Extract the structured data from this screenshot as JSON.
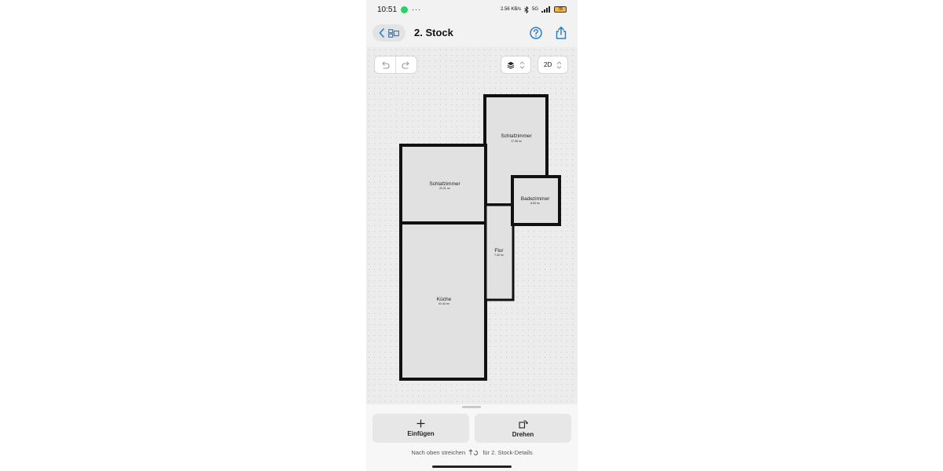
{
  "status_bar": {
    "time": "10:51",
    "overflow": "···",
    "net_speed": "2.56 KB/s",
    "network": "5G",
    "battery": "78",
    "icons": [
      "whatsapp-icon",
      "bluetooth-icon",
      "signal-icon",
      "battery-icon"
    ]
  },
  "header": {
    "title": "2. Stock",
    "back_icon": "chevron-left-icon",
    "floors_icon": "floors-icon",
    "help_icon": "question-circle-icon",
    "share_icon": "share-icon"
  },
  "toolbar": {
    "undo_icon": "undo-icon",
    "redo_icon": "redo-icon",
    "layers_icon": "layers-icon",
    "view_mode": "2D"
  },
  "rooms": [
    {
      "name": "Schlafzimmer",
      "area": "17.05 m²"
    },
    {
      "name": "Schlafzimmer",
      "area": "20.21 m²"
    },
    {
      "name": "Badezimmer",
      "area": "6.53 m²"
    },
    {
      "name": "Flur",
      "area": "7.42 m²"
    },
    {
      "name": "Küche",
      "area": "41.44 m²"
    }
  ],
  "bottom_sheet": {
    "insert_label": "Einfügen",
    "rotate_label": "Drehen",
    "hint_prefix": "Nach oben streichen",
    "hint_suffix": "für 2. Stock-Details"
  },
  "colors": {
    "accent": "#2b7fc7",
    "wall": "#111111",
    "room_fill": "#e1e1e1"
  }
}
